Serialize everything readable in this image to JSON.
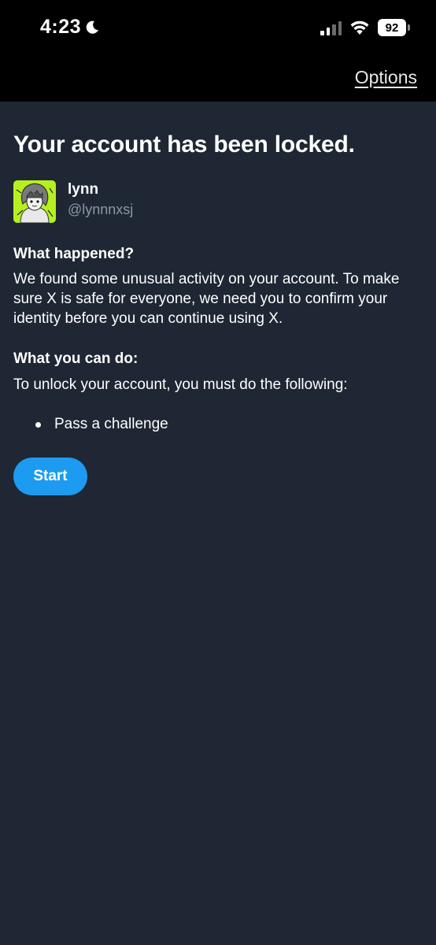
{
  "status_bar": {
    "time": "4:23",
    "battery": "92",
    "icons": [
      "moon-icon",
      "cellular-signal-icon",
      "wifi-icon",
      "battery-icon"
    ]
  },
  "header": {
    "options_label": "Options"
  },
  "page": {
    "title": "Your account has been locked."
  },
  "user": {
    "name": "lynn",
    "handle": "@lynnnxsj",
    "avatar_bg": "#b6f01f"
  },
  "sections": {
    "what_happened": {
      "heading": "What happened?",
      "body": "We found some unusual activity on your account. To make sure X is safe for everyone, we need you to confirm your identity before you can continue using X."
    },
    "what_you_can_do": {
      "heading": "What you can do:",
      "body": "To unlock your account, you must do the following:",
      "steps": [
        "Pass a challenge"
      ]
    }
  },
  "actions": {
    "start_label": "Start"
  },
  "colors": {
    "background": "#1e2733",
    "top_bar": "#000000",
    "accent": "#1d9bf0",
    "secondary_text": "#8b98a5"
  }
}
